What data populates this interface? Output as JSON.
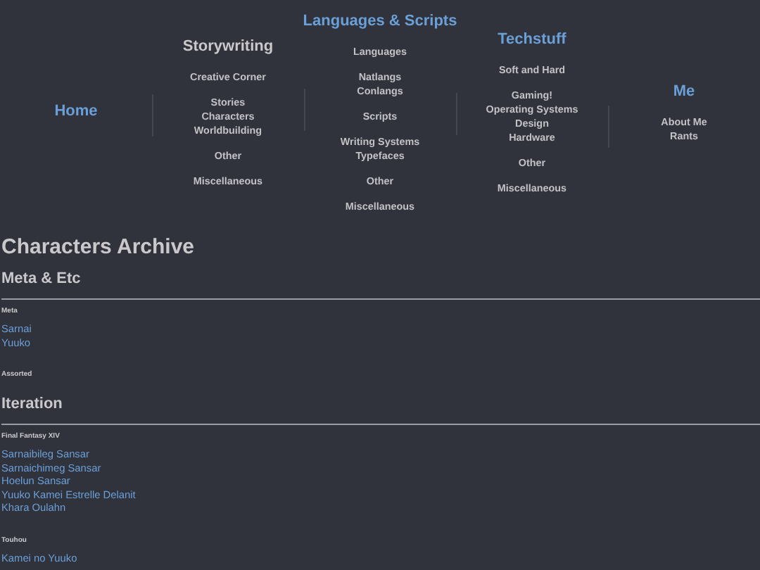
{
  "nav": [
    {
      "title": "Home",
      "kind": "link"
    },
    {
      "title": "Storywriting",
      "kind": "heading",
      "groups": [
        [
          "Creative Corner"
        ],
        [
          "Stories",
          "Characters",
          "Worldbuilding"
        ],
        [
          "Other"
        ],
        [
          "Miscellaneous"
        ]
      ]
    },
    {
      "title": "Languages & Scripts",
      "kind": "link",
      "groups": [
        [
          "Languages"
        ],
        [
          "Natlangs",
          "Conlangs"
        ],
        [
          "Scripts"
        ],
        [
          "Writing Systems",
          "Typefaces"
        ],
        [
          "Other"
        ],
        [
          "Miscellaneous"
        ]
      ]
    },
    {
      "title": "Techstuff",
      "kind": "link",
      "groups": [
        [
          "Soft and Hard"
        ],
        [
          "Gaming!",
          "Operating Systems",
          "Design",
          "Hardware"
        ],
        [
          "Other"
        ],
        [
          "Miscellaneous"
        ]
      ]
    },
    {
      "title": "Me",
      "kind": "link",
      "groups": [
        [
          "About Me",
          "Rants"
        ]
      ]
    }
  ],
  "archive": {
    "title": "Characters Archive",
    "sections": [
      {
        "heading": "Meta & Etc",
        "groups": [
          {
            "label": "Meta",
            "entries": [
              "Sarnai",
              "Yuuko"
            ]
          },
          {
            "label": "Assorted"
          }
        ]
      },
      {
        "heading": "Iteration",
        "groups": [
          {
            "label": "Final Fantasy XIV",
            "entries": [
              "Sarnaibileg Sansar",
              "Sarnaichimeg Sansar",
              "Hoelun Sansar",
              "Yuuko Kamei Estrelle Delanit",
              "Khara Oulahn"
            ]
          },
          {
            "label": "Touhou",
            "entries": [
              "Kamei no Yuuko"
            ]
          }
        ]
      }
    ]
  }
}
